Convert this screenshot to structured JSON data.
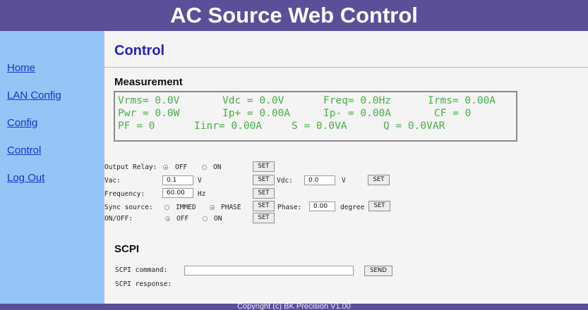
{
  "header": {
    "title": "AC Source Web Control"
  },
  "sidebar": {
    "items": [
      {
        "label": "Home"
      },
      {
        "label": "LAN Config"
      },
      {
        "label": "Config"
      },
      {
        "label": "Control"
      },
      {
        "label": "Log Out"
      }
    ]
  },
  "page": {
    "title": "Control"
  },
  "measurement": {
    "title": "Measurement",
    "vrms": "Vrms= 0.0V",
    "vdc": "Vdc = 0.0V",
    "freq": "Freq= 0.0Hz",
    "irms": "Irms= 0.00A",
    "pwr": "Pwr = 0.0W",
    "ip_plus": "Ip+ = 0.00A",
    "ip_minus": "Ip- = 0.00A",
    "cf": "CF = 0",
    "pf": "PF = 0",
    "iinr": "Iinr= 0.00A",
    "s": "S = 0.0VA",
    "q": "Q = 0.0VAR"
  },
  "controls": {
    "output_relay_label": "Output Relay:",
    "off_label": "OFF",
    "on_label": "ON",
    "vac_label": "Vac:",
    "vac_value": "0.1",
    "vac_unit": "V",
    "vdc_label": "Vdc:",
    "vdc_value": "0.0",
    "vdc_unit": "V",
    "frequency_label": "Frequency:",
    "frequency_value": "60.00",
    "frequency_unit": "Hz",
    "sync_label": "Sync source:",
    "immed_label": "IMMED",
    "phase_option_label": "PHASE",
    "phase_label": "Phase:",
    "phase_value": "0.00",
    "phase_unit": "degree",
    "onoff_label": "ON/OFF:",
    "set_label": "SET",
    "output_relay_selected": "OFF",
    "sync_selected": "PHASE",
    "onoff_selected": "OFF"
  },
  "scpi": {
    "title": "SCPI",
    "command_label": "SCPI command:",
    "command_value": "",
    "send_label": "SEND",
    "response_label": "SCPI response:"
  },
  "footer": {
    "text": "Copyright (c) BK Precision V1.00"
  },
  "colors": {
    "header_bg": "#5b4f9a",
    "sidebar_bg": "#95c5f7",
    "link": "#1a2fcc",
    "title": "#2323b8",
    "measurement_text": "#45b045"
  }
}
